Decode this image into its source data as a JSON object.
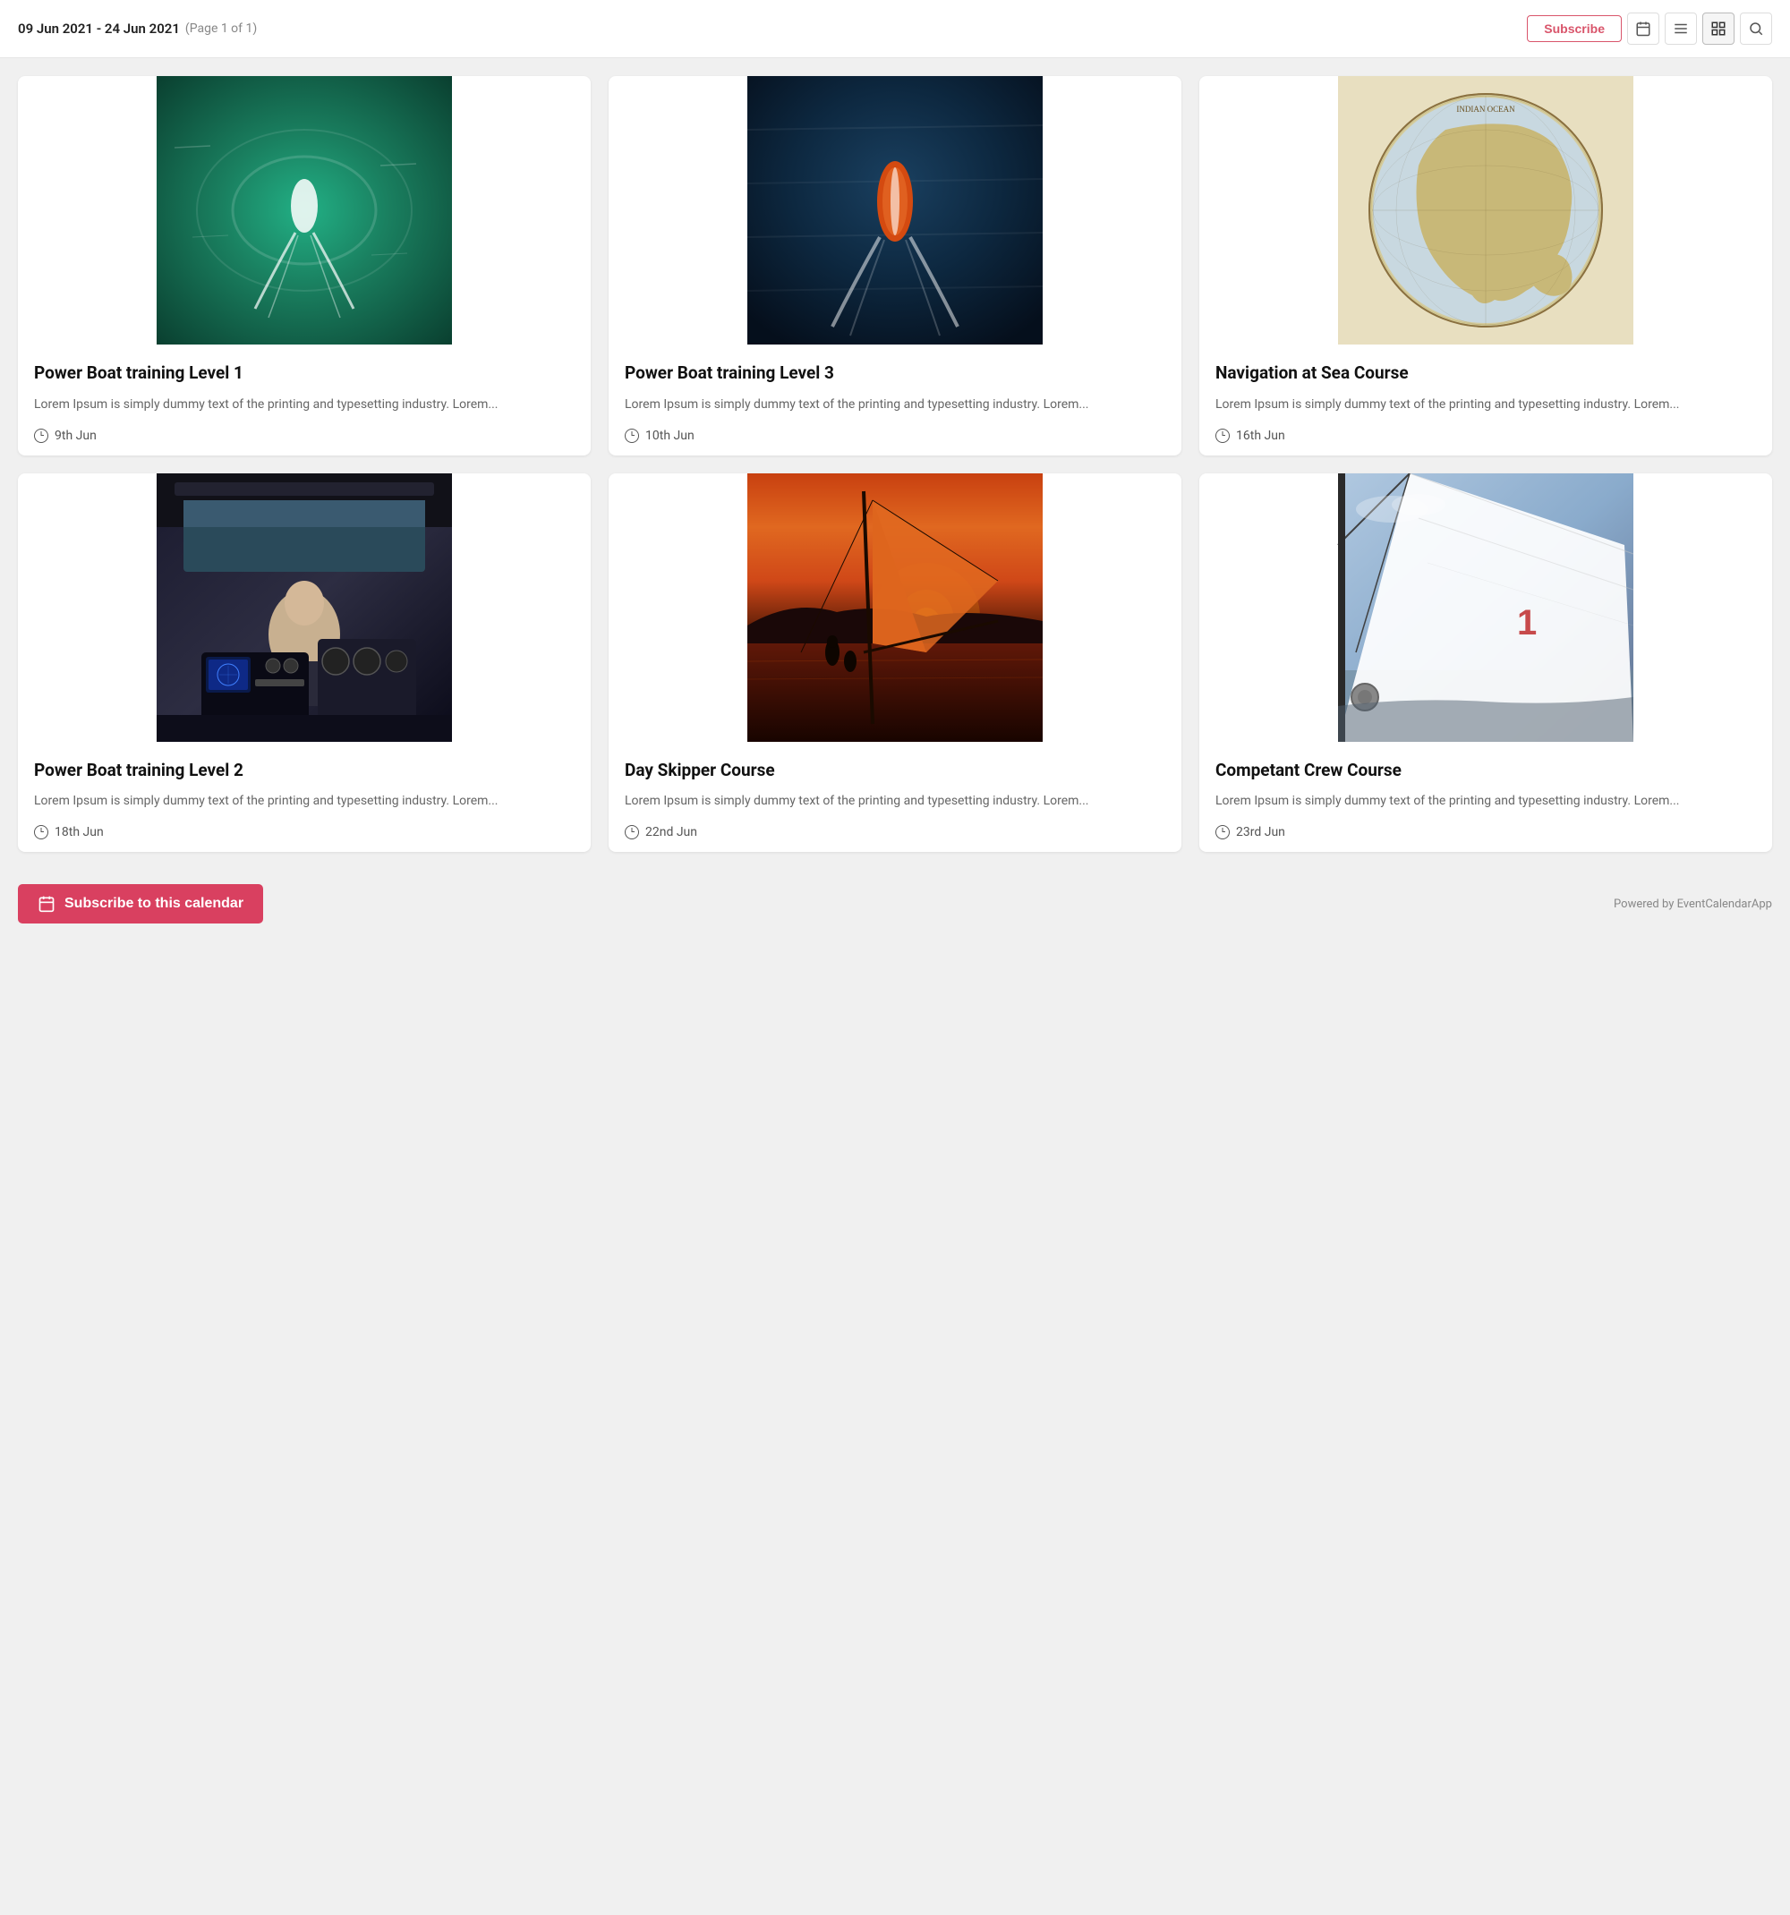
{
  "header": {
    "date_range": "09 Jun 2021 - 24 Jun 2021",
    "page_info": "(Page 1 of 1)",
    "subscribe_label": "Subscribe",
    "icon_calendar": "📅",
    "icon_list": "☰",
    "icon_grid": "▦",
    "icon_search": "🔍"
  },
  "events": [
    {
      "id": "event-1",
      "title": "Power Boat training Level 1",
      "description": "Lorem Ipsum is simply dummy text of the printing and typesetting industry. Lorem...",
      "date": "9th Jun",
      "image_type": "boat1"
    },
    {
      "id": "event-2",
      "title": "Power Boat training Level 3",
      "description": "Lorem Ipsum is simply dummy text of the printing and typesetting industry. Lorem...",
      "date": "10th Jun",
      "image_type": "boat2"
    },
    {
      "id": "event-3",
      "title": "Navigation at Sea Course",
      "description": "Lorem Ipsum is simply dummy text of the printing and typesetting industry. Lorem...",
      "date": "16th Jun",
      "image_type": "map"
    },
    {
      "id": "event-4",
      "title": "Power Boat training Level 2",
      "description": "Lorem Ipsum is simply dummy text of the printing and typesetting industry. Lorem...",
      "date": "18th Jun",
      "image_type": "cockpit"
    },
    {
      "id": "event-5",
      "title": "Day Skipper Course",
      "description": "Lorem Ipsum is simply dummy text of the printing and typesetting industry. Lorem...",
      "date": "22nd Jun",
      "image_type": "sunset-sail"
    },
    {
      "id": "event-6",
      "title": "Competant Crew Course",
      "description": "Lorem Ipsum is simply dummy text of the printing and typesetting industry. Lorem...",
      "date": "23rd Jun",
      "image_type": "sail-close"
    }
  ],
  "footer": {
    "subscribe_label": "Subscribe to this calendar",
    "powered_by": "Powered by EventCalendarApp"
  }
}
